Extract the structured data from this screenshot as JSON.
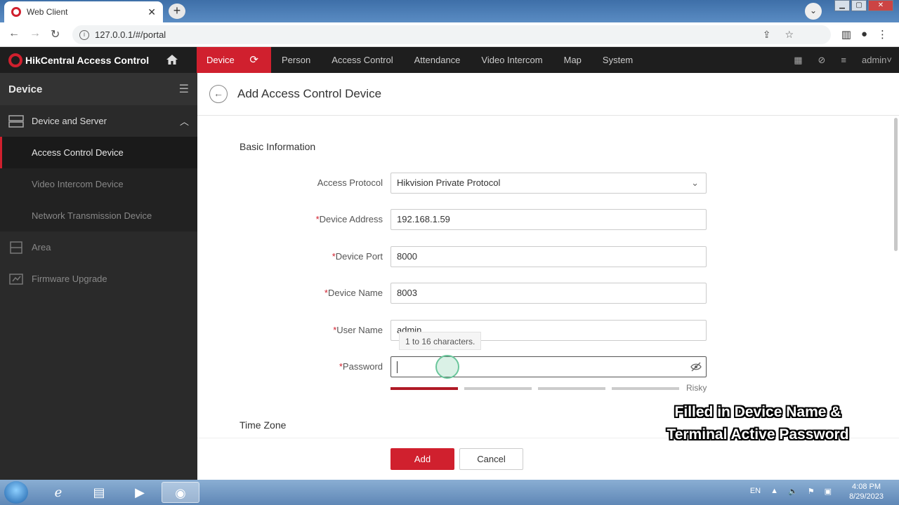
{
  "browser": {
    "tab_title": "Web Client",
    "url": "127.0.0.1/#/portal"
  },
  "app": {
    "product_name": "HikCentral Access Control",
    "nav": [
      "Device",
      "Person",
      "Access Control",
      "Attendance",
      "Video Intercom",
      "Map",
      "System"
    ],
    "user": "admin"
  },
  "sidebar": {
    "title": "Device",
    "group": "Device and Server",
    "subitems": [
      "Access Control Device",
      "Video Intercom Device",
      "Network Transmission Device"
    ],
    "others": [
      "Area",
      "Firmware Upgrade"
    ]
  },
  "page": {
    "title": "Add Access Control Device",
    "section_basic": "Basic Information",
    "section_timezone": "Time Zone",
    "fields": {
      "protocol_label": "Access Protocol",
      "protocol_value": "Hikvision Private Protocol",
      "address_label": "Device Address",
      "address_value": "192.168.1.59",
      "port_label": "Device Port",
      "port_value": "8000",
      "name_label": "Device Name",
      "name_value": "8003",
      "username_label": "User Name",
      "username_value": "admin",
      "password_label": "Password",
      "password_value": ""
    },
    "tooltip": "1 to 16 characters.",
    "strength_label": "Risky",
    "strength_level": 1,
    "required_mark": "*",
    "add_label": "Add",
    "cancel_label": "Cancel"
  },
  "caption": {
    "line1": "Filled in Device Name &",
    "line2": "Terminal Active Password"
  },
  "taskbar": {
    "lang": "EN",
    "time": "4:08 PM",
    "date": "8/29/2023"
  },
  "colors": {
    "accent": "#d0202e",
    "dark_bar": "#1e1e1e",
    "sidebar": "#2a2a2a"
  }
}
